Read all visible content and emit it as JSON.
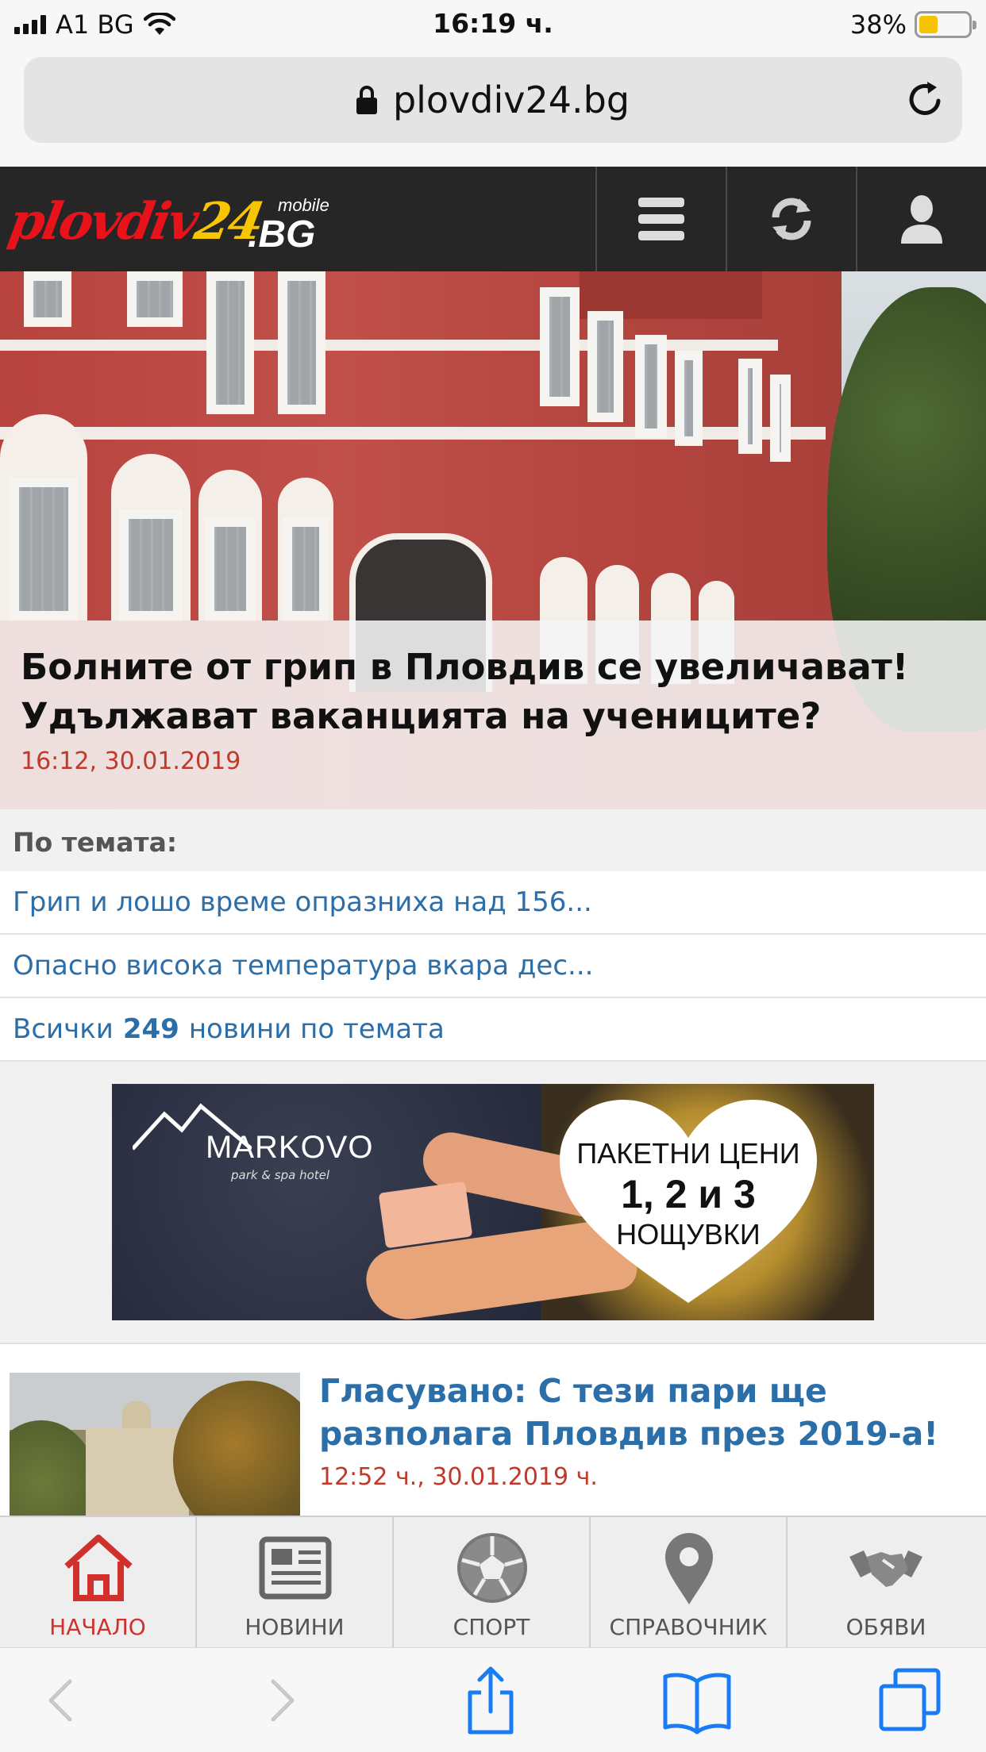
{
  "status_bar": {
    "carrier": "A1 BG",
    "time": "16:19 ч.",
    "battery_percent": "38%",
    "battery_level": 0.38,
    "battery_color": "#f5c400"
  },
  "address_bar": {
    "url": "plovdiv24.bg",
    "lock_icon": "lock-icon",
    "reload_icon": "reload-icon"
  },
  "site_header": {
    "logo": {
      "word": "plovdiv",
      "number": "24",
      "suffix": ".BG",
      "tag": "mobile"
    },
    "buttons": [
      "menu-icon",
      "refresh-icon",
      "user-icon"
    ]
  },
  "hero": {
    "title": "Болните от грип в Пловдив се увеличават! Удължават ваканцията на учениците?",
    "date": "16:12, 30.01.2019"
  },
  "related": {
    "heading": "По темата:",
    "links": [
      "Грип и лошо време опразниха над 156...",
      "Опасно висока температура вкара дес..."
    ],
    "all_prefix": "Всички",
    "all_count": "249",
    "all_suffix": "новини по темата"
  },
  "ad": {
    "brand": "MARKOVO",
    "brand_sub": "park & spa hotel",
    "line1": "ПАКЕТНИ ЦЕНИ",
    "line2": "1, 2 и 3",
    "line3": "НОЩУВКИ"
  },
  "article": {
    "title": "Гласувано: С тези пари ще разполага Пловдив през 2019-а!",
    "date": "12:52 ч., 30.01.2019 ч."
  },
  "tabbar": {
    "tabs": [
      {
        "label": "НАЧАЛО",
        "icon": "home-icon",
        "active": true
      },
      {
        "label": "НОВИНИ",
        "icon": "newspaper-icon",
        "active": false
      },
      {
        "label": "СПОРТ",
        "icon": "soccer-ball-icon",
        "active": false
      },
      {
        "label": "СПРАВОЧНИК",
        "icon": "map-pin-icon",
        "active": false
      },
      {
        "label": "ОБЯВИ",
        "icon": "handshake-icon",
        "active": false
      }
    ]
  },
  "safari_toolbar": {
    "buttons": [
      "back-icon",
      "forward-icon",
      "share-icon",
      "bookmarks-icon",
      "tabs-icon"
    ]
  },
  "colors": {
    "header_bg": "#262626",
    "link_blue": "#2b6ea8",
    "date_red": "#c0392b",
    "active_tab": "#d0312d",
    "logo_red": "#e8131a",
    "logo_yellow": "#f7c600"
  }
}
